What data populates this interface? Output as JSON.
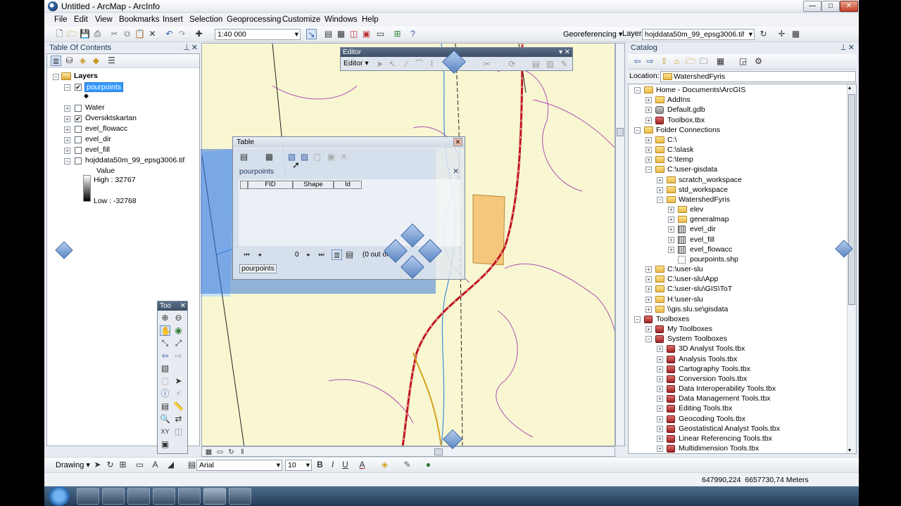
{
  "window": {
    "title": "Untitled - ArcMap - ArcInfo",
    "min": "—",
    "max": "□",
    "close": "✕"
  },
  "menu": [
    "File",
    "Edit",
    "View",
    "Bookmarks",
    "Insert",
    "Selection",
    "Geoprocessing",
    "Customize",
    "Windows",
    "Help"
  ],
  "toolbar": {
    "scale": "1:40 000",
    "georeferencing": "Georeferencing ▾",
    "layer_label": "Layer:",
    "layer_value": "hojddata50m_99_epsg3006.tif"
  },
  "toc": {
    "title": "Table Of Contents",
    "group": "Layers",
    "layers": [
      {
        "name": "pourpoints",
        "checked": true,
        "selected": true
      },
      {
        "name": "Water",
        "checked": false
      },
      {
        "name": "Översiktskartan",
        "checked": true
      },
      {
        "name": "evel_flowacc",
        "checked": false
      },
      {
        "name": "evel_dir",
        "checked": false
      },
      {
        "name": "evel_fill",
        "checked": false
      },
      {
        "name": "hojddata50m_99_epsg3006.tif",
        "checked": false
      }
    ],
    "legend": {
      "label": "Value",
      "high": "High : 32767",
      "low": "Low : -32768"
    }
  },
  "editor": {
    "title": "Editor",
    "menu": "Editor ▾"
  },
  "table": {
    "title": "Table",
    "subtitle": "pourpoints",
    "columns": [
      "FID",
      "Shape",
      "Id"
    ],
    "record": "0",
    "count_text": "(0 out of",
    "tab": "pourpoints"
  },
  "tools": {
    "title": "Too"
  },
  "catalog": {
    "title": "Catalog",
    "location_label": "Location:",
    "location_value": "WatershedFyris",
    "rows": [
      {
        "t": "Home - Documents\\ArcGIS",
        "lv": 0,
        "ic": "folder",
        "ex": "-"
      },
      {
        "t": "AddIns",
        "lv": 1,
        "ic": "folder",
        "ex": "+"
      },
      {
        "t": "Default.gdb",
        "lv": 1,
        "ic": "gdb",
        "ex": "+"
      },
      {
        "t": "Toolbox.tbx",
        "lv": 1,
        "ic": "tbx",
        "ex": "+"
      },
      {
        "t": "Folder Connections",
        "lv": 0,
        "ic": "folder",
        "ex": "-"
      },
      {
        "t": "C:\\",
        "lv": 1,
        "ic": "folder",
        "ex": "+"
      },
      {
        "t": "C:\\slask",
        "lv": 1,
        "ic": "folder",
        "ex": "+"
      },
      {
        "t": "C:\\temp",
        "lv": 1,
        "ic": "folder",
        "ex": "+"
      },
      {
        "t": "C:\\user-gisdata",
        "lv": 1,
        "ic": "folder",
        "ex": "-"
      },
      {
        "t": "scratch_workspace",
        "lv": 2,
        "ic": "folder",
        "ex": "+"
      },
      {
        "t": "std_workspace",
        "lv": 2,
        "ic": "folder",
        "ex": "+"
      },
      {
        "t": "WatershedFyris",
        "lv": 2,
        "ic": "folder",
        "ex": "-"
      },
      {
        "t": "elev",
        "lv": 3,
        "ic": "folder",
        "ex": "+"
      },
      {
        "t": "generalmap",
        "lv": 3,
        "ic": "folder",
        "ex": "+"
      },
      {
        "t": "evel_dir",
        "lv": 3,
        "ic": "raster",
        "ex": "+"
      },
      {
        "t": "evel_fill",
        "lv": 3,
        "ic": "raster",
        "ex": "+"
      },
      {
        "t": "evel_flowacc",
        "lv": 3,
        "ic": "raster",
        "ex": "+"
      },
      {
        "t": "pourpoints.shp",
        "lv": 3,
        "ic": "shp",
        "ex": ""
      },
      {
        "t": "C:\\user-slu",
        "lv": 1,
        "ic": "folder",
        "ex": "+"
      },
      {
        "t": "C:\\user-slu\\App",
        "lv": 1,
        "ic": "folder",
        "ex": "+"
      },
      {
        "t": "C:\\user-slu\\GIS\\ToT",
        "lv": 1,
        "ic": "folder",
        "ex": "+"
      },
      {
        "t": "H:\\user-slu",
        "lv": 1,
        "ic": "folder",
        "ex": "+"
      },
      {
        "t": "\\\\gis.slu.se\\gisdata",
        "lv": 1,
        "ic": "folder",
        "ex": "+"
      },
      {
        "t": "Toolboxes",
        "lv": 0,
        "ic": "tbx",
        "ex": "-"
      },
      {
        "t": "My Toolboxes",
        "lv": 1,
        "ic": "tbx",
        "ex": "+"
      },
      {
        "t": "System Toolboxes",
        "lv": 1,
        "ic": "tbx",
        "ex": "-"
      },
      {
        "t": "3D Analyst Tools.tbx",
        "lv": 2,
        "ic": "tbx",
        "ex": "+"
      },
      {
        "t": "Analysis Tools.tbx",
        "lv": 2,
        "ic": "tbx",
        "ex": "+"
      },
      {
        "t": "Cartography Tools.tbx",
        "lv": 2,
        "ic": "tbx",
        "ex": "+"
      },
      {
        "t": "Conversion Tools.tbx",
        "lv": 2,
        "ic": "tbx",
        "ex": "+"
      },
      {
        "t": "Data Interoperability Tools.tbx",
        "lv": 2,
        "ic": "tbx",
        "ex": "+"
      },
      {
        "t": "Data Management Tools.tbx",
        "lv": 2,
        "ic": "tbx",
        "ex": "+"
      },
      {
        "t": "Editing Tools.tbx",
        "lv": 2,
        "ic": "tbx",
        "ex": "+"
      },
      {
        "t": "Geocoding Tools.tbx",
        "lv": 2,
        "ic": "tbx",
        "ex": "+"
      },
      {
        "t": "Geostatistical Analyst Tools.tbx",
        "lv": 2,
        "ic": "tbx",
        "ex": "+"
      },
      {
        "t": "Linear Referencing Tools.tbx",
        "lv": 2,
        "ic": "tbx",
        "ex": "+"
      },
      {
        "t": "Multidimension Tools.tbx",
        "lv": 2,
        "ic": "tbx",
        "ex": "+"
      }
    ]
  },
  "drawing": {
    "label": "Drawing ▾",
    "font": "Arial",
    "size": "10",
    "bold": "B",
    "italic": "I",
    "underline": "U"
  },
  "status": {
    "coords": "647990,224  6657730,74 Meters"
  },
  "colors": {
    "map_bg": "#f8f7d2",
    "road": "#c0151e",
    "contour": "#b04fb5",
    "river": "#3a8fd8",
    "selection": "#3c78d8"
  }
}
